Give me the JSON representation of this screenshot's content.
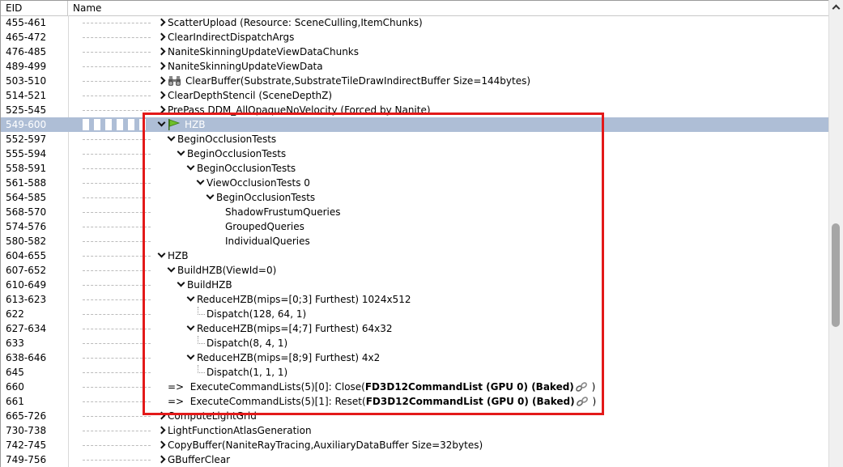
{
  "columns": {
    "eid": "EID",
    "name": "Name"
  },
  "rows": [
    {
      "eid": "455-461",
      "label": "ScatterUpload (Resource: SceneCulling,ItemChunks)",
      "chev": "r",
      "indent": 0
    },
    {
      "eid": "465-472",
      "label": "ClearIndirectDispatchArgs",
      "chev": "r",
      "indent": 0
    },
    {
      "eid": "476-485",
      "label": "NaniteSkinningUpdateViewDataChunks",
      "chev": "r",
      "indent": 0
    },
    {
      "eid": "489-499",
      "label": "NaniteSkinningUpdateViewData",
      "chev": "r",
      "indent": 0
    },
    {
      "eid": "503-510",
      "label": "ClearBuffer(Substrate,SubstrateTileDrawIndirectBuffer Size=144bytes)",
      "chev": "r",
      "indent": 0,
      "icon": "binoculars-icon"
    },
    {
      "eid": "514-521",
      "label": "ClearDepthStencil (SceneDepthZ)",
      "chev": "r",
      "indent": 0
    },
    {
      "eid": "525-545",
      "label": "PrePass DDM_AllOpaqueNoVelocity (Forced by Nanite)",
      "chev": "r",
      "indent": 0
    },
    {
      "eid": "549-600",
      "label": "HZB",
      "chev": "d",
      "indent": 0,
      "icon": "flag-icon",
      "selected": true
    },
    {
      "eid": "552-597",
      "label": "BeginOcclusionTests",
      "chev": "d",
      "indent": 1
    },
    {
      "eid": "555-594",
      "label": "BeginOcclusionTests",
      "chev": "d",
      "indent": 2
    },
    {
      "eid": "558-591",
      "label": "BeginOcclusionTests",
      "chev": "d",
      "indent": 3
    },
    {
      "eid": "561-588",
      "label": "ViewOcclusionTests 0",
      "chev": "d",
      "indent": 4
    },
    {
      "eid": "564-585",
      "label": "BeginOcclusionTests",
      "chev": "d",
      "indent": 5
    },
    {
      "eid": "568-570",
      "label": "ShadowFrustumQueries",
      "chev": "",
      "indent": 6
    },
    {
      "eid": "574-576",
      "label": "GroupedQueries",
      "chev": "",
      "indent": 6
    },
    {
      "eid": "580-582",
      "label": "IndividualQueries",
      "chev": "",
      "indent": 6
    },
    {
      "eid": "604-655",
      "label": "HZB",
      "chev": "d",
      "indent": 0
    },
    {
      "eid": "607-652",
      "label": "BuildHZB(ViewId=0)",
      "chev": "d",
      "indent": 1
    },
    {
      "eid": "610-649",
      "label": "BuildHZB",
      "chev": "d",
      "indent": 2
    },
    {
      "eid": "613-623",
      "label": "ReduceHZB(mips=[0;3] Furthest) 1024x512",
      "chev": "d",
      "indent": 3
    },
    {
      "eid": "622",
      "label": "Dispatch(128, 64, 1)",
      "chev": "leaf",
      "indent": 4
    },
    {
      "eid": "627-634",
      "label": "ReduceHZB(mips=[4;7] Furthest) 64x32",
      "chev": "d",
      "indent": 3
    },
    {
      "eid": "633",
      "label": "Dispatch(8, 4, 1)",
      "chev": "leaf",
      "indent": 4
    },
    {
      "eid": "638-646",
      "label": "ReduceHZB(mips=[8;9] Furthest) 4x2",
      "chev": "d",
      "indent": 3
    },
    {
      "eid": "645",
      "label": "Dispatch(1, 1, 1)",
      "chev": "leaf",
      "indent": 4
    },
    {
      "eid": "660",
      "label": "=>  ExecuteCommandLists(5)[0]: Close(",
      "bold": "FD3D12CommandList (GPU 0) (Baked)",
      "tail": " )",
      "chev": "",
      "indent": 1,
      "icon": "link-icon"
    },
    {
      "eid": "661",
      "label": "=>  ExecuteCommandLists(5)[1]: Reset(",
      "bold": "FD3D12CommandList (GPU 0) (Baked)",
      "tail": " )",
      "chev": "",
      "indent": 1,
      "icon": "link-icon"
    },
    {
      "eid": "665-726",
      "label": "ComputeLightGrid",
      "chev": "r",
      "indent": 0
    },
    {
      "eid": "730-738",
      "label": "LightFunctionAtlasGeneration",
      "chev": "r",
      "indent": 0
    },
    {
      "eid": "742-745",
      "label": "CopyBuffer(NaniteRayTracing,AuxiliaryDataBuffer Size=32bytes)",
      "chev": "r",
      "indent": 0
    },
    {
      "eid": "749-756",
      "label": "GBufferClear",
      "chev": "r",
      "indent": 0
    }
  ]
}
